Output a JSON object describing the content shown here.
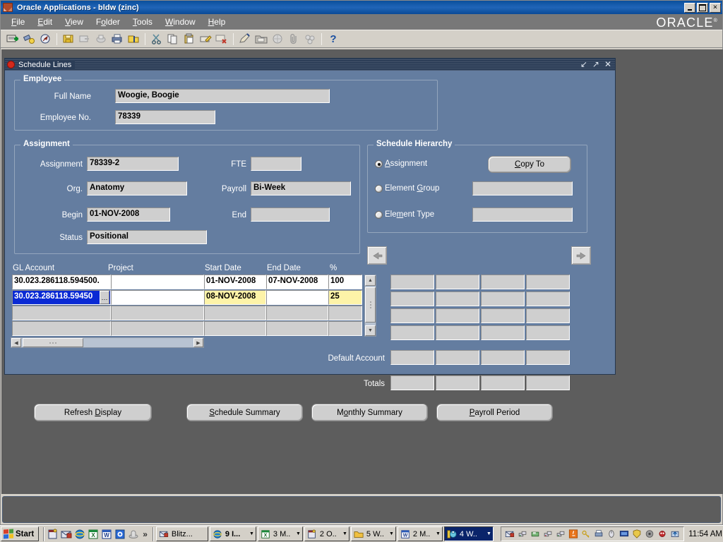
{
  "window": {
    "title": "Oracle Applications - bldw (zinc)",
    "app_icon": "oracle-app-icon",
    "controls": {
      "minimize": "minimize-button",
      "maximize": "maximize-button",
      "close": "close-button"
    }
  },
  "menubar": {
    "items": [
      {
        "label": "File",
        "mnemonic": "F"
      },
      {
        "label": "Edit",
        "mnemonic": "E"
      },
      {
        "label": "View",
        "mnemonic": "V"
      },
      {
        "label": "Folder",
        "mnemonic": "o"
      },
      {
        "label": "Tools",
        "mnemonic": "T"
      },
      {
        "label": "Window",
        "mnemonic": "W"
      },
      {
        "label": "Help",
        "mnemonic": "H"
      }
    ],
    "brand": "ORACLE"
  },
  "toolbar": {
    "buttons": [
      "new-icon",
      "find-icon",
      "show-navigator-icon",
      "save-icon",
      "next-step-icon",
      "print-setup-icon",
      "print-icon",
      "close-form-icon",
      "cut-icon",
      "copy-icon",
      "paste-icon",
      "edit-field-icon",
      "clear-record-icon",
      "attachment-edit-icon",
      "folder-tools-icon",
      "window-help-icon",
      "attachment-icon",
      "tools-icon",
      "help-icon"
    ]
  },
  "child_window": {
    "title": "Schedule Lines",
    "icon": "oracle-form-icon",
    "buttons": {
      "minimize": "minimize-icon",
      "restore": "restore-icon",
      "close": "close-icon"
    }
  },
  "employee": {
    "legend": "Employee",
    "full_name_label": "Full Name",
    "full_name_value": "Woogie, Boogie",
    "employee_no_label": "Employee No.",
    "employee_no_value": "78339"
  },
  "assignment": {
    "legend": "Assignment",
    "assignment_label": "Assignment",
    "assignment_value": "78339-2",
    "fte_label": "FTE",
    "fte_value": "",
    "org_label": "Org.",
    "org_value": "Anatomy",
    "payroll_label": "Payroll",
    "payroll_value": "Bi-Week",
    "begin_label": "Begin",
    "begin_value": "01-NOV-2008",
    "end_label": "End",
    "end_value": "",
    "status_label": "Status",
    "status_value": "Positional"
  },
  "schedule_hierarchy": {
    "legend": "Schedule Hierarchy",
    "options": [
      {
        "label": "Assignment",
        "mnemonic": "A",
        "selected": true,
        "value": ""
      },
      {
        "label": "Element Group",
        "mnemonic": "G",
        "selected": false,
        "value": ""
      },
      {
        "label": "Element Type",
        "mnemonic": "m",
        "selected": false,
        "value": ""
      }
    ],
    "copy_to_label": "Copy To",
    "copy_to_mnemonic": "C"
  },
  "navigation": {
    "prev_label": "previous-arrow-icon",
    "next_label": "next-arrow-icon"
  },
  "grid": {
    "columns": [
      "GL Account",
      "Project",
      "Start Date",
      "End Date",
      "%"
    ],
    "rows": [
      {
        "gl_account": "30.023.286118.594500.",
        "project": "",
        "start_date": "01-NOV-2008",
        "end_date": "07-NOV-2008",
        "percent": "100",
        "state": "entry",
        "selected": false
      },
      {
        "gl_account": "30.023.286118.59450",
        "project": "",
        "start_date": "08-NOV-2008",
        "end_date": "",
        "percent": "25",
        "state": "current",
        "selected": true,
        "lov_button": "list-of-values-button"
      },
      {
        "gl_account": "",
        "project": "",
        "start_date": "",
        "end_date": "",
        "percent": "",
        "state": "disabled",
        "selected": false
      },
      {
        "gl_account": "",
        "project": "",
        "start_date": "",
        "end_date": "",
        "percent": "",
        "state": "disabled",
        "selected": false
      }
    ]
  },
  "amounts_grid": {
    "rows": 4,
    "cols": 4,
    "default_account_label": "Default Account",
    "default_account_values": [
      "",
      "",
      "",
      ""
    ],
    "totals_label": "Totals",
    "totals_values": [
      "",
      "",
      "",
      ""
    ]
  },
  "action_buttons": [
    {
      "label": "Refresh Display",
      "mnemonic": "D",
      "name": "refresh-display-button"
    },
    {
      "label": "Schedule Summary",
      "mnemonic": "S",
      "name": "schedule-summary-button"
    },
    {
      "label": "Monthly Summary",
      "mnemonic": "o",
      "name": "monthly-summary-button"
    },
    {
      "label": "Payroll Period",
      "mnemonic": "P",
      "name": "payroll-period-button"
    }
  ],
  "taskbar": {
    "start_label": "Start",
    "quick_launch": [
      "notes-icon",
      "mail-icon",
      "internet-explorer-icon",
      "excel-icon",
      "word-icon",
      "outlook-icon",
      "setup-icon"
    ],
    "overflow": "»",
    "tasks": [
      {
        "label": "Blitz...",
        "icon": "mail-icon",
        "active": false,
        "group": false
      },
      {
        "label": "9 I...",
        "icon": "internet-explorer-icon",
        "active": false,
        "group": true
      },
      {
        "label": "3 M..",
        "icon": "excel-icon",
        "active": false,
        "group": true
      },
      {
        "label": "2 O..",
        "icon": "notes-icon",
        "active": false,
        "group": true
      },
      {
        "label": "5 W..",
        "icon": "folder-icon",
        "active": false,
        "group": true
      },
      {
        "label": "2 M..",
        "icon": "word-icon",
        "active": false,
        "group": true
      },
      {
        "label": "4 W..",
        "icon": "oracle-forms-icon",
        "active": true,
        "group": true
      }
    ],
    "tray_icons": [
      "mail-icon",
      "network-icon",
      "disk-icon",
      "network-icon",
      "network-icon",
      "java-icon",
      "key-icon",
      "printer-icon",
      "mouse-icon",
      "monitor-icon",
      "shield-icon",
      "volume-icon",
      "antivirus-icon",
      "update-icon"
    ],
    "clock": "11:54 AM"
  },
  "colors": {
    "titlebar_blue": "#0b4f9c",
    "form_canvas": "#647da0",
    "field_gray": "#cfcfcf",
    "entry_white": "#ffffff",
    "current_yellow": "#fdf3a8",
    "selection_blue": "#0a2ad4",
    "desktop_gray": "#5d5d5d",
    "taskbar_face": "#d4d0c8",
    "active_task_blue": "#0a246a"
  }
}
